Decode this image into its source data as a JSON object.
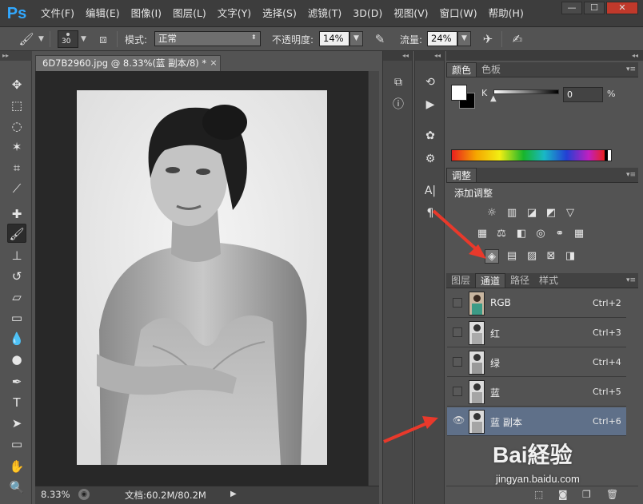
{
  "app": {
    "logo": "Ps"
  },
  "menu": [
    "文件(F)",
    "编辑(E)",
    "图像(I)",
    "图层(L)",
    "文字(Y)",
    "选择(S)",
    "滤镜(T)",
    "3D(D)",
    "视图(V)",
    "窗口(W)",
    "帮助(H)"
  ],
  "window_controls": {
    "minimize": "—",
    "maximize": "☐",
    "close": "✕"
  },
  "options": {
    "brush_size": "30",
    "mode_label": "模式:",
    "mode_value": "正常",
    "opacity_label": "不透明度:",
    "opacity_value": "14%",
    "flow_label": "流量:",
    "flow_value": "24%"
  },
  "document": {
    "tab_title": "6D7B2960.jpg @ 8.33%(蓝 副本/8) *",
    "close": "×",
    "zoom": "8.33%",
    "doc_size": "文档:60.2M/80.2M"
  },
  "color_panel": {
    "tabs": [
      "颜色",
      "色板"
    ],
    "channel_label": "K",
    "value": "0",
    "unit": "%"
  },
  "adjustments_panel": {
    "tab": "调整",
    "title": "添加调整"
  },
  "channels_panel": {
    "tabs": [
      "图层",
      "通道",
      "路径",
      "样式"
    ],
    "active_tab": 1,
    "channels": [
      {
        "name": "RGB",
        "shortcut": "Ctrl+2",
        "visible": false,
        "selected": false
      },
      {
        "name": "红",
        "shortcut": "Ctrl+3",
        "visible": false,
        "selected": false
      },
      {
        "name": "绿",
        "shortcut": "Ctrl+4",
        "visible": false,
        "selected": false
      },
      {
        "name": "蓝",
        "shortcut": "Ctrl+5",
        "visible": false,
        "selected": false
      },
      {
        "name": "蓝 副本",
        "shortcut": "Ctrl+6",
        "visible": true,
        "selected": true
      }
    ]
  },
  "watermark": {
    "brand": "Bai経验",
    "url": "jingyan.baidu.com"
  },
  "colors": {
    "accent": "#31a8ff",
    "selected_row": "#5f7089",
    "annotation_arrow": "#e8392b"
  }
}
